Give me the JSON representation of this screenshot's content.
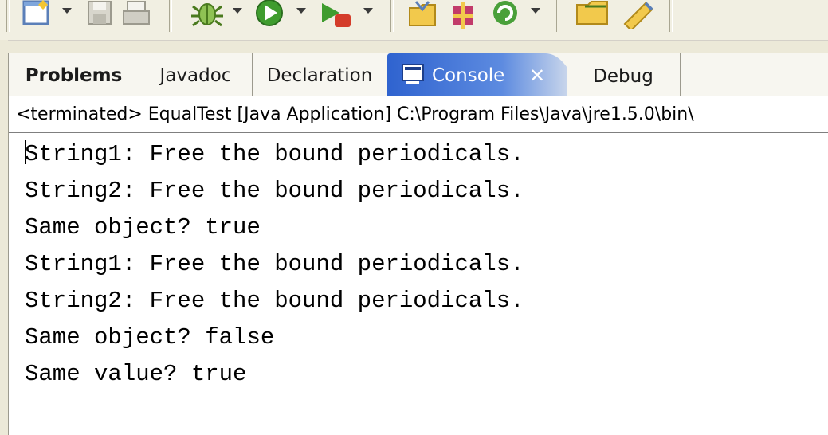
{
  "tabs": {
    "problems": "Problems",
    "javadoc": "Javadoc",
    "declaration": "Declaration",
    "console": "Console",
    "console_close": "✕",
    "debug": "Debug"
  },
  "console": {
    "header": "<terminated> EqualTest [Java Application] C:\\Program Files\\Java\\jre1.5.0\\bin\\",
    "lines": [
      "String1: Free the bound periodicals.",
      "String2: Free the bound periodicals.",
      "Same object? true",
      "String1: Free the bound periodicals.",
      "String2: Free the bound periodicals.",
      "Same object? false",
      "Same value? true"
    ]
  },
  "toolbar": {
    "icons": [
      "new-file-icon",
      "save-icon",
      "print-icon",
      "debug-icon",
      "run-icon",
      "external-tools-icon",
      "open-type-icon",
      "open-resource-icon",
      "refresh-icon",
      "open-folder-icon",
      "edit-icon"
    ]
  },
  "colors": {
    "active_tab": "#3a6fd6",
    "window_bg": "#ece9d8"
  }
}
